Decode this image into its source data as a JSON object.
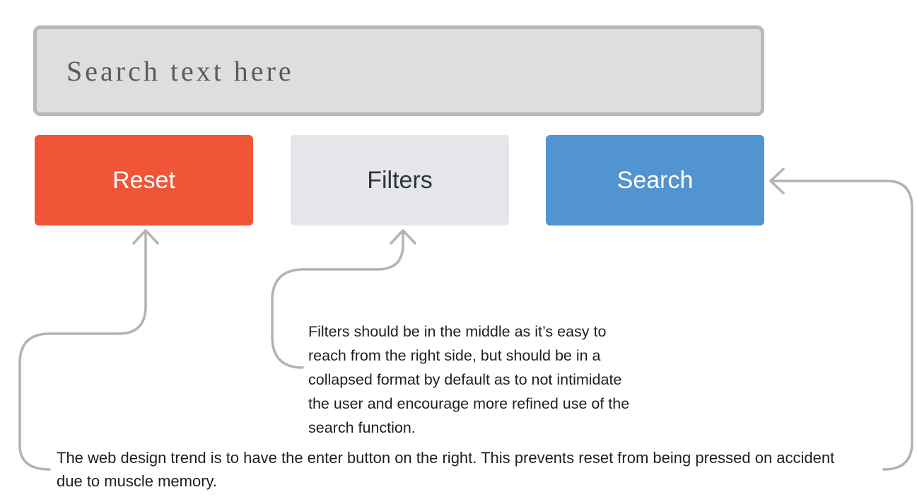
{
  "search": {
    "placeholder": "Search text here"
  },
  "buttons": {
    "reset_label": "Reset",
    "filters_label": "Filters",
    "search_label": "Search"
  },
  "annotations": {
    "filters_note": "Filters should be in the middle as it’s easy to reach from the right side, but should be in a collapsed format by default as to not intimidate the user and encourage more refined use of the search function.",
    "trend_note": "The web design trend is to have the enter button on the right. This prevents reset from being pressed on accident due to muscle memory."
  },
  "colors": {
    "search_box_fill": "#dedede",
    "search_box_border": "#b9b9b9",
    "reset_button": "#f05538",
    "filters_button": "#e5e6e9",
    "search_button": "#5294cf",
    "arrow_stroke": "#b3b3b3"
  },
  "icons": {
    "reset_pointer": "arrow-up-icon",
    "filters_pointer": "arrow-up-icon",
    "search_pointer": "arrow-left-icon"
  }
}
